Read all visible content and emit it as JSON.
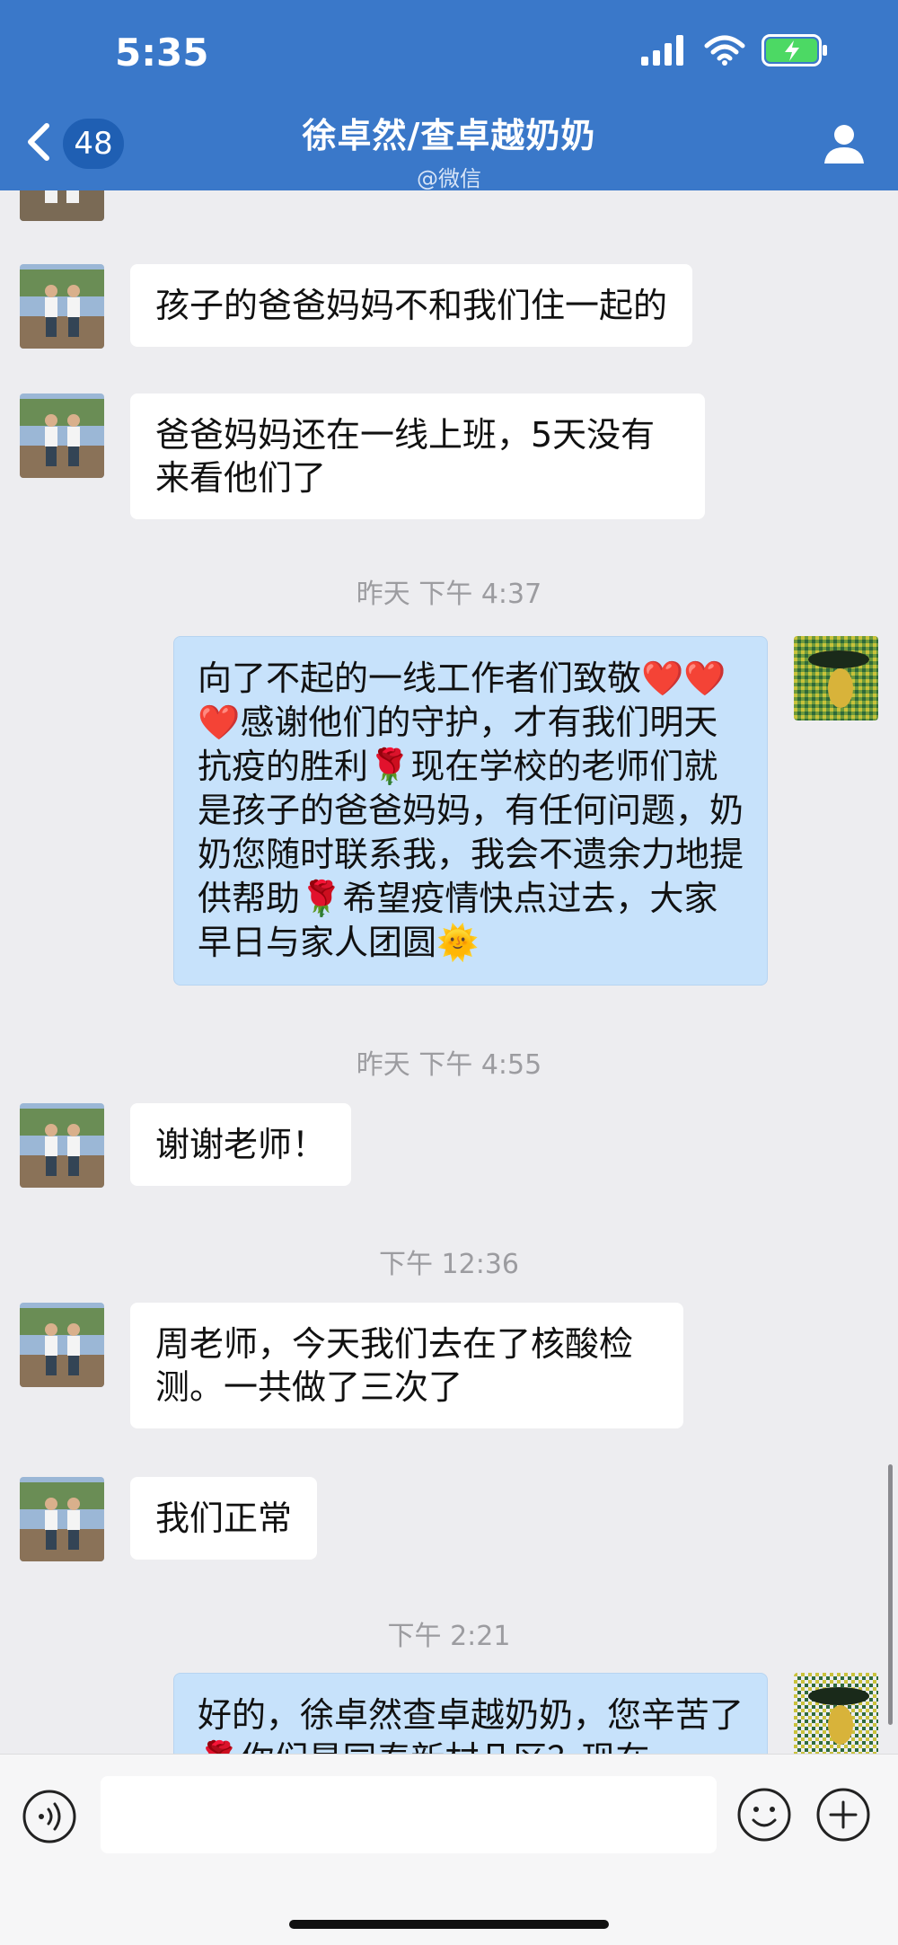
{
  "status": {
    "time": "5:35"
  },
  "header": {
    "back_count": "48",
    "title": "徐卓然/查卓越奶奶",
    "subtitle": "@微信"
  },
  "messages": [
    {
      "text": "孩子的爸爸妈妈不和我们住一起的"
    },
    {
      "text": "爸爸妈妈还在一线上班，5天没有来看他们了"
    },
    {
      "time": "昨天 下午 4:37"
    },
    {
      "text": "向了不起的一线工作者们致敬❤️❤️❤️感谢他们的守护，才有我们明天抗疫的胜利🌹现在学校的老师们就是孩子的爸爸妈妈，有任何问题，奶奶您随时联系我，我会不遗余力地提供帮助🌹希望疫情快点过去，大家早日与家人团圆🌞"
    },
    {
      "time": "昨天 下午 4:55"
    },
    {
      "text": "谢谢老师！"
    },
    {
      "time": "下午 12:36"
    },
    {
      "text": "周老师，今天我们去在了核酸检测。一共做了三次了"
    },
    {
      "text": "我们正常"
    },
    {
      "time": "下午 2:21"
    },
    {
      "text": "好的，徐卓然查卓越奶奶，您辛苦了🌹你们是同泰新村几区？现在"
    }
  ],
  "colors": {
    "header": "#3a78c9",
    "bubble_out": "#c7e2fb",
    "bubble_in": "#ffffff",
    "background": "#ededf0"
  },
  "icons": [
    "back-chevron-icon",
    "profile-icon",
    "voice-icon",
    "emoji-icon",
    "plus-icon",
    "signal-icon",
    "wifi-icon",
    "battery-icon"
  ]
}
